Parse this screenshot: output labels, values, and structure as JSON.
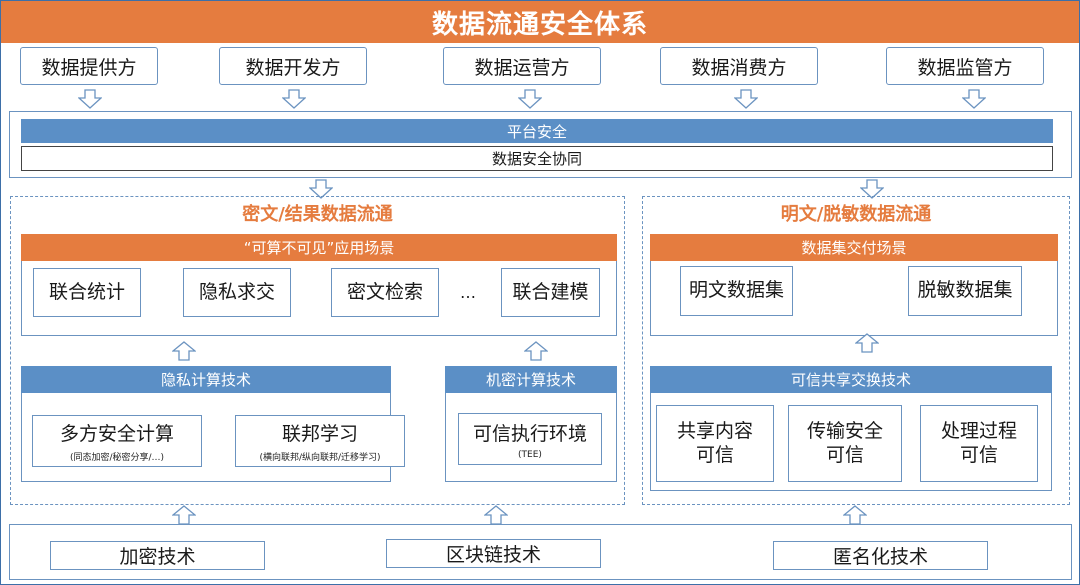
{
  "title": "数据流通安全体系",
  "roles": [
    "数据提供方",
    "数据开发方",
    "数据运营方",
    "数据消费方",
    "数据监管方"
  ],
  "platform": {
    "security_label": "平台安全",
    "collab_label": "数据安全协同"
  },
  "left_region": {
    "title": "密文/结果数据流通",
    "scenario_header": "“可算不可见”应用场景",
    "scenarios": [
      "联合统计",
      "隐私求交",
      "密文检索",
      "联合建模"
    ],
    "ellipsis": "…",
    "privacy_tech": {
      "header": "隐私计算技术",
      "items": [
        {
          "name": "多方安全计算",
          "sub": "(同态加密/秘密分享/…)"
        },
        {
          "name": "联邦学习",
          "sub": "(横向联邦/纵向联邦/迁移学习)"
        }
      ]
    },
    "confidential_tech": {
      "header": "机密计算技术",
      "item": {
        "name": "可信执行环境",
        "sub": "(TEE)"
      }
    }
  },
  "right_region": {
    "title": "明文/脱敏数据流通",
    "scenario_header": "数据集交付场景",
    "datasets": [
      "明文数据集",
      "脱敏数据集"
    ],
    "trusted_tech": {
      "header": "可信共享交换技术",
      "items": [
        [
          "共享内容",
          "可信"
        ],
        [
          "传输安全",
          "可信"
        ],
        [
          "处理过程",
          "可信"
        ]
      ]
    }
  },
  "base_tech": [
    "加密技术",
    "区块链技术",
    "匿名化技术"
  ],
  "colors": {
    "accent_orange": "#e57c3f",
    "accent_blue": "#5b8fc6",
    "border_blue": "#6b93c0"
  }
}
